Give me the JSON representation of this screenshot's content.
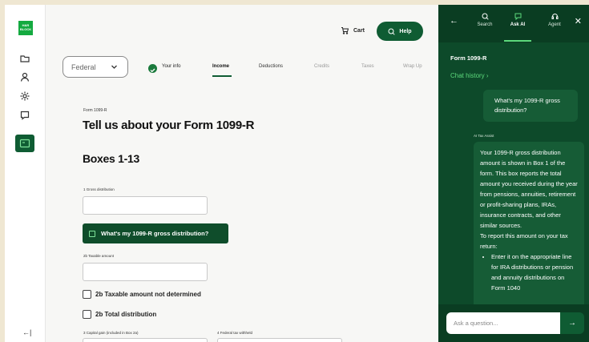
{
  "brand": {
    "logo_text": "H&R BLOCK",
    "accent": "#0f5c33",
    "accent_light": "#5cd97c"
  },
  "rail": {
    "icons": [
      "folder-icon",
      "user-icon",
      "gear-icon",
      "chat-icon",
      "document-icon"
    ],
    "collapse_label": "←|"
  },
  "header": {
    "cart_label": "Cart",
    "help_label": "Help"
  },
  "jurisdiction": {
    "selected": "Federal"
  },
  "steps": [
    {
      "label": "Your info",
      "state": "done"
    },
    {
      "label": "Income",
      "state": "active"
    },
    {
      "label": "Deductions",
      "state": "upcoming"
    },
    {
      "label": "Credits",
      "state": "upcoming"
    },
    {
      "label": "Taxes",
      "state": "upcoming"
    },
    {
      "label": "Wrap Up",
      "state": "upcoming"
    }
  ],
  "form": {
    "form_label": "Form 1099-R",
    "title": "Tell us about your Form 1099-R",
    "section_title": "Boxes 1-13",
    "gross_distribution_label": "1 Gross distribution",
    "gross_distribution_value": "",
    "ai_button_label": "What's my 1099-R gross distribution?",
    "taxable_amount_label": "2b Taxable amount",
    "taxable_amount_value": "",
    "not_determined_label": "2b Taxable amount not determined",
    "total_distribution_label": "2b Total distribution",
    "capital_gain_label": "3 Capital gain (included in Box 2a)",
    "federal_withheld_label": "4 Federal tax withheld"
  },
  "panel": {
    "tabs": [
      {
        "label": "Search",
        "icon": "search-icon"
      },
      {
        "label": "Ask AI",
        "icon": "chat-bubble-icon",
        "active": true
      },
      {
        "label": "Agent",
        "icon": "headset-icon"
      }
    ],
    "form_name": "Form 1099-R",
    "chat_history_label": "Chat history",
    "user_message": "What's my 1099-R gross distribution?",
    "ai_label": "AI Tax Assist",
    "ai_message_p1": "Your 1099-R gross distribution amount is shown in Box 1 of the form. This box reports the total amount you received during the year from pensions, annuities, retirement or profit-sharing plans, IRAs, insurance contracts, and other similar sources.",
    "ai_message_p2": "To report this amount on your tax return:",
    "ai_message_bullet": "Enter it on the appropriate line for IRA distributions or pension and annuity distributions on Form 1040",
    "ask_placeholder": "Ask a question...",
    "send_icon": "→"
  }
}
